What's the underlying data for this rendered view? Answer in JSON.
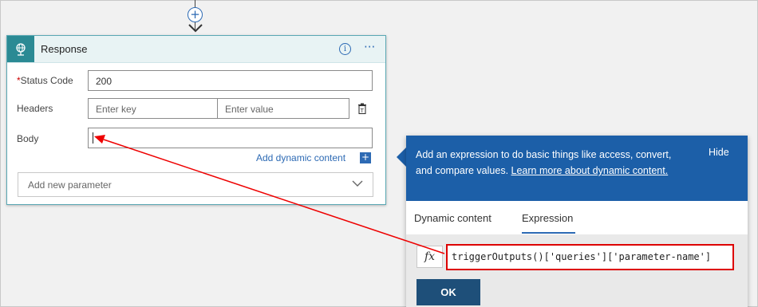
{
  "card": {
    "title": "Response",
    "fields": {
      "status_code_label": "Status Code",
      "status_code_required": "*",
      "status_code_value": "200",
      "headers_label": "Headers",
      "key_placeholder": "Enter key",
      "value_placeholder": "Enter value",
      "body_label": "Body",
      "body_value": ""
    },
    "add_dynamic_content": "Add dynamic content",
    "add_new_parameter": "Add new parameter"
  },
  "panel": {
    "banner_text": "Add an expression to do basic things like access, convert, and compare values.",
    "banner_link": "Learn more about dynamic content.",
    "hide_label": "Hide",
    "tabs": [
      {
        "label": "Dynamic content",
        "active": false
      },
      {
        "label": "Expression",
        "active": true
      }
    ],
    "fx_symbol": "fx",
    "expression_value": "triggerOutputs()['queries']['parameter-name']",
    "ok_label": "OK"
  },
  "colors": {
    "accent": "#2d6ab4",
    "banner": "#1c5fa8",
    "card_icon": "#2b8a94",
    "highlight": "#dd0000",
    "ok_button": "#1e4f79"
  },
  "icons": {
    "add": "plus-circle-icon",
    "arrow": "arrow-down-icon",
    "card": "globe-icon",
    "info": "info-icon",
    "more": "more-icon",
    "delete": "delete-icon",
    "add_dynamic": "plus-square-icon",
    "dropdown": "chevron-down-icon"
  }
}
